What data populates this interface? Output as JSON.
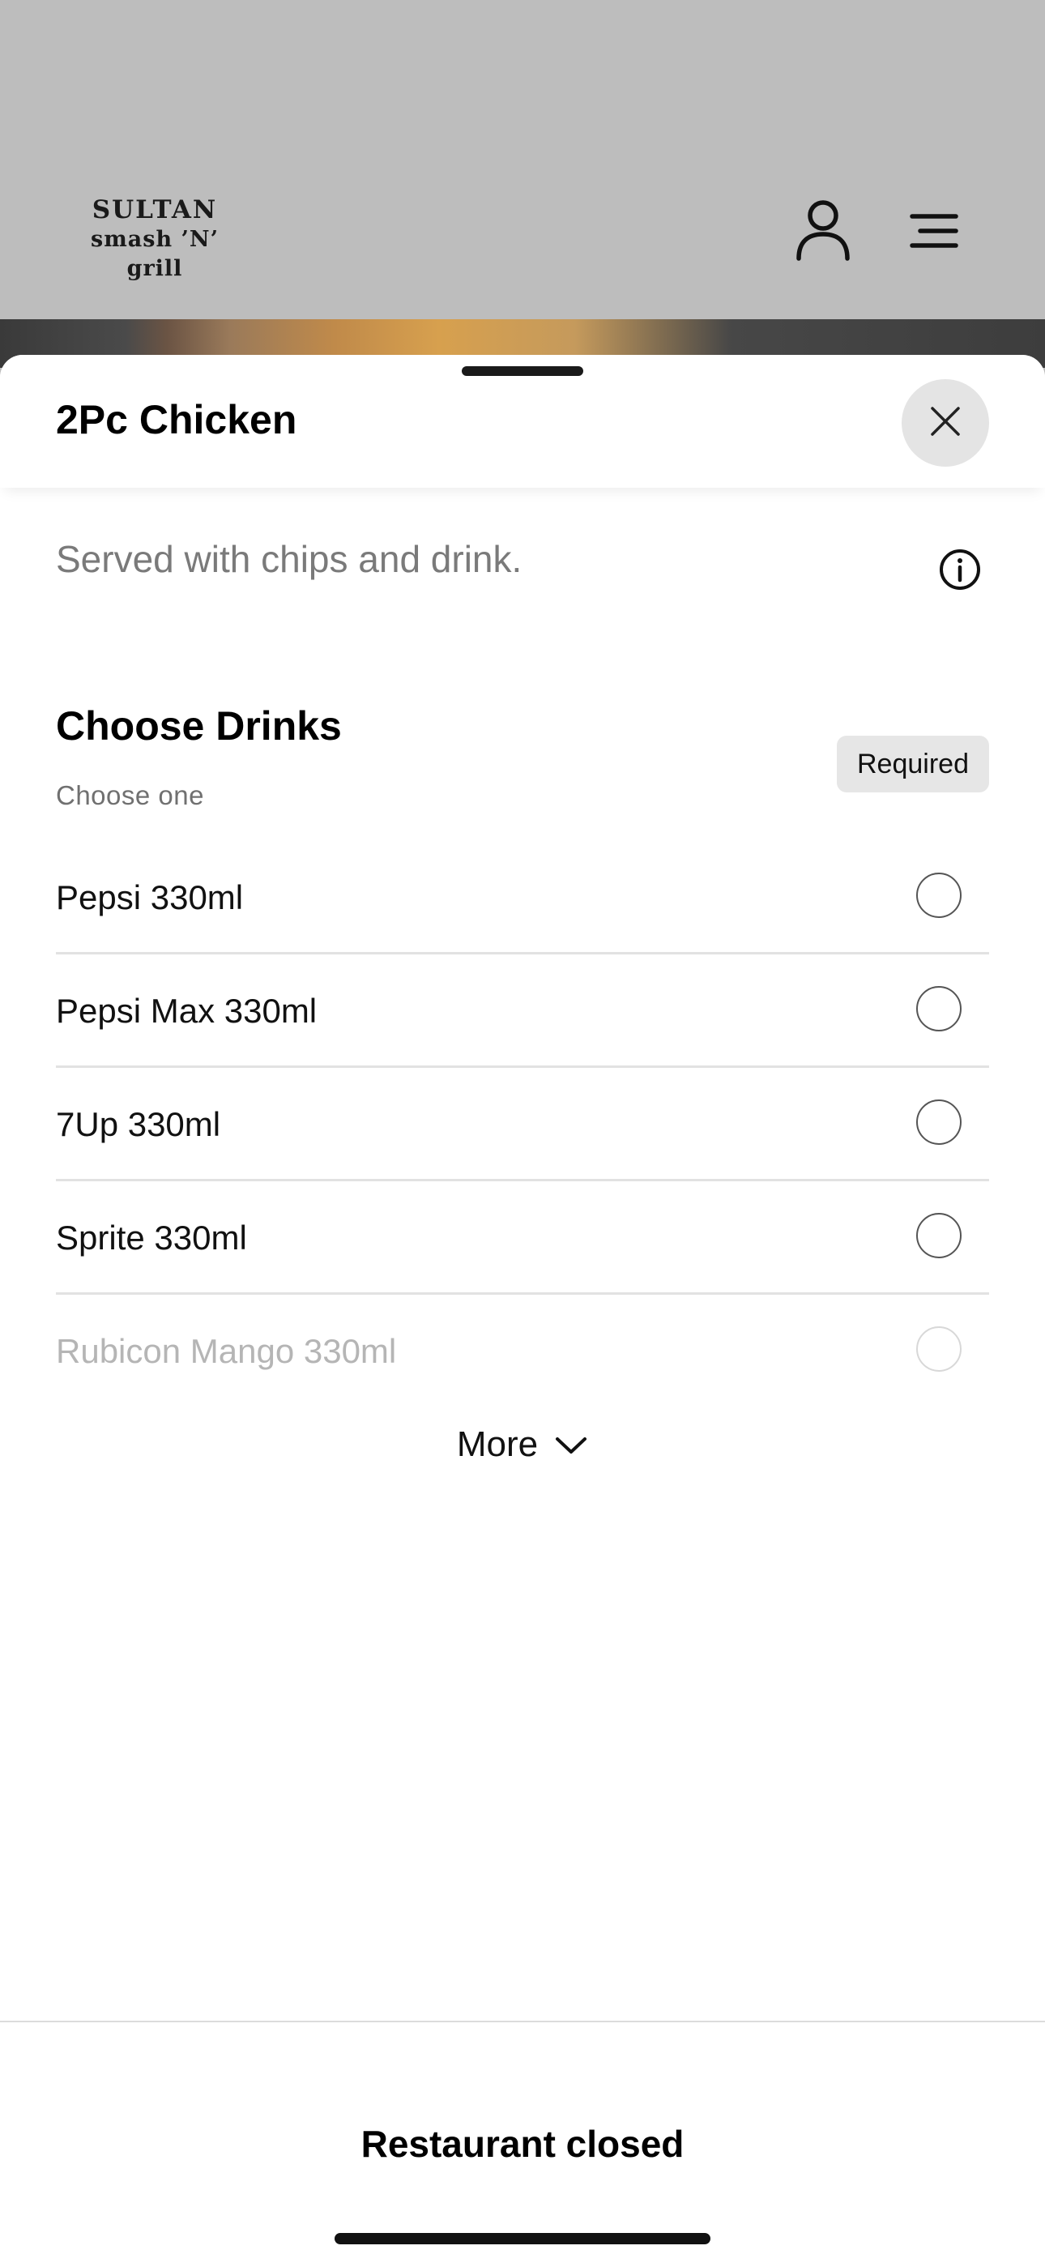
{
  "header": {
    "logo_line1": "SULTAN",
    "logo_line2": "smash ’N’ grill",
    "account_icon": "person-icon",
    "menu_icon": "hamburger-menu-icon"
  },
  "sheet": {
    "title": "2Pc Chicken",
    "close_icon": "close-icon",
    "description": "Served with chips and drink.",
    "info_icon": "info-icon",
    "group": {
      "title": "Choose Drinks",
      "subtitle": "Choose one",
      "badge": "Required",
      "options": [
        {
          "label": "Pepsi 330ml",
          "selected": false
        },
        {
          "label": "Pepsi Max 330ml",
          "selected": false
        },
        {
          "label": "7Up 330ml",
          "selected": false
        },
        {
          "label": "Sprite 330ml",
          "selected": false
        },
        {
          "label": "Rubicon Mango 330ml",
          "selected": false
        }
      ],
      "more_label": "More"
    }
  },
  "footer": {
    "status": "Restaurant closed"
  },
  "colors": {
    "backdrop": "#bdbdbd",
    "sheet_bg": "#ffffff",
    "badge_bg": "#e6e6e6",
    "close_bg": "#e4e4e4"
  }
}
